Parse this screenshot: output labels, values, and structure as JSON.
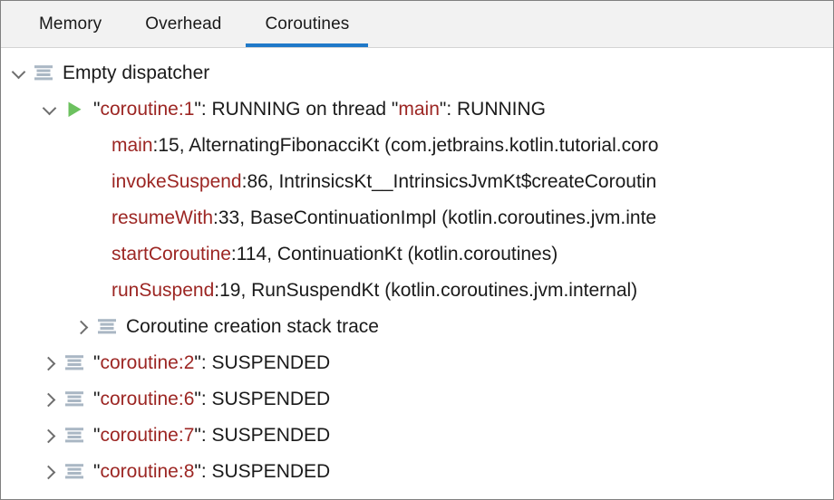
{
  "window": {
    "title": "Coroutines",
    "border_color": "#808080",
    "background": "#ffffff"
  },
  "tabbar": {
    "background": "#f2f2f2",
    "accent_color": "#1f79c8",
    "tabs": [
      {
        "label": "Memory",
        "selected": false
      },
      {
        "label": "Overhead",
        "selected": false
      },
      {
        "label": "Coroutines",
        "selected": true
      }
    ]
  },
  "colors": {
    "identifier_red": "#9c2623",
    "text": "#1a1a1a",
    "icon_blue_gray": "#aab7c4",
    "running_green": "#6cc15f",
    "chevron_gray": "#6e6e6e"
  },
  "tree": {
    "rows": [
      {
        "id": "empty-dispatcher",
        "indent": 0,
        "toggle": "down",
        "icon": "coroutine-stack-icon",
        "segments": [
          {
            "text": "Empty dispatcher",
            "style": "plain"
          }
        ]
      },
      {
        "id": "coroutine-1",
        "indent": 1,
        "toggle": "down",
        "icon": "running-play-icon",
        "segments": [
          {
            "text": "\"",
            "style": "plain"
          },
          {
            "text": "coroutine:1",
            "style": "red"
          },
          {
            "text": "\": RUNNING on thread \"",
            "style": "plain"
          },
          {
            "text": "main",
            "style": "red"
          },
          {
            "text": "\": RUNNING",
            "style": "plain"
          }
        ]
      },
      {
        "id": "frame-main",
        "indent": "leaf",
        "toggle": "none",
        "icon": "none",
        "segments": [
          {
            "text": "main",
            "style": "red"
          },
          {
            "text": ":15, AlternatingFibonacciKt (com.jetbrains.kotlin.tutorial.coro",
            "style": "plain"
          }
        ]
      },
      {
        "id": "frame-invokesuspend",
        "indent": "leaf",
        "toggle": "none",
        "icon": "none",
        "segments": [
          {
            "text": "invokeSuspend",
            "style": "red"
          },
          {
            "text": ":86, IntrinsicsKt__IntrinsicsJvmKt$createCoroutin",
            "style": "plain"
          }
        ]
      },
      {
        "id": "frame-resumewith",
        "indent": "leaf",
        "toggle": "none",
        "icon": "none",
        "segments": [
          {
            "text": "resumeWith",
            "style": "red"
          },
          {
            "text": ":33, BaseContinuationImpl (kotlin.coroutines.jvm.inte",
            "style": "plain"
          }
        ]
      },
      {
        "id": "frame-startcoroutine",
        "indent": "leaf",
        "toggle": "none",
        "icon": "none",
        "segments": [
          {
            "text": "startCoroutine",
            "style": "red"
          },
          {
            "text": ":114, ContinuationKt (kotlin.coroutines)",
            "style": "plain"
          }
        ]
      },
      {
        "id": "frame-runsuspend",
        "indent": "leaf",
        "toggle": "none",
        "icon": "none",
        "segments": [
          {
            "text": "runSuspend",
            "style": "red"
          },
          {
            "text": ":19, RunSuspendKt (kotlin.coroutines.jvm.internal)",
            "style": "plain"
          }
        ]
      },
      {
        "id": "creation-stack-trace",
        "indent": 2,
        "toggle": "right",
        "icon": "coroutine-stack-icon",
        "segments": [
          {
            "text": "Coroutine creation stack trace",
            "style": "plain"
          }
        ]
      },
      {
        "id": "coroutine-2",
        "indent": 1,
        "toggle": "right",
        "icon": "coroutine-stack-icon",
        "segments": [
          {
            "text": "\"",
            "style": "plain"
          },
          {
            "text": "coroutine:2",
            "style": "red"
          },
          {
            "text": "\": SUSPENDED",
            "style": "plain"
          }
        ]
      },
      {
        "id": "coroutine-6",
        "indent": 1,
        "toggle": "right",
        "icon": "coroutine-stack-icon",
        "segments": [
          {
            "text": "\"",
            "style": "plain"
          },
          {
            "text": "coroutine:6",
            "style": "red"
          },
          {
            "text": "\": SUSPENDED",
            "style": "plain"
          }
        ]
      },
      {
        "id": "coroutine-7",
        "indent": 1,
        "toggle": "right",
        "icon": "coroutine-stack-icon",
        "segments": [
          {
            "text": "\"",
            "style": "plain"
          },
          {
            "text": "coroutine:7",
            "style": "red"
          },
          {
            "text": "\": SUSPENDED",
            "style": "plain"
          }
        ]
      },
      {
        "id": "coroutine-8",
        "indent": 1,
        "toggle": "right",
        "icon": "coroutine-stack-icon",
        "segments": [
          {
            "text": "\"",
            "style": "plain"
          },
          {
            "text": "coroutine:8",
            "style": "red"
          },
          {
            "text": "\": SUSPENDED",
            "style": "plain"
          }
        ]
      }
    ]
  }
}
